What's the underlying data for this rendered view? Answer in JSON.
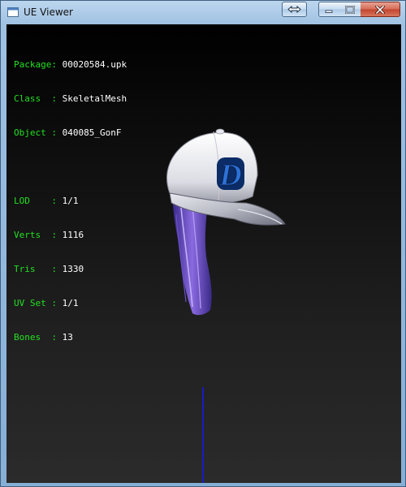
{
  "window": {
    "title": "UE Viewer"
  },
  "info": {
    "package": {
      "label": "Package",
      "value": "00020584.upk"
    },
    "class": {
      "label": "Class  ",
      "value": "SkeletalMesh"
    },
    "object": {
      "label": "Object ",
      "value": "040085_GonF"
    },
    "lod": {
      "label": "LOD    ",
      "value": "1/1"
    },
    "verts": {
      "label": "Verts  ",
      "value": "1116"
    },
    "tris": {
      "label": "Tris   ",
      "value": "1330"
    },
    "uvset": {
      "label": "UV Set ",
      "value": "1/1"
    },
    "bones": {
      "label": "Bones  ",
      "value": "13"
    },
    "separator": ": "
  },
  "model": {
    "logo_letter": "D"
  },
  "colors": {
    "label_green": "#22e122",
    "value_white": "#ffffff",
    "axis_blue": "#1a1ac8"
  }
}
